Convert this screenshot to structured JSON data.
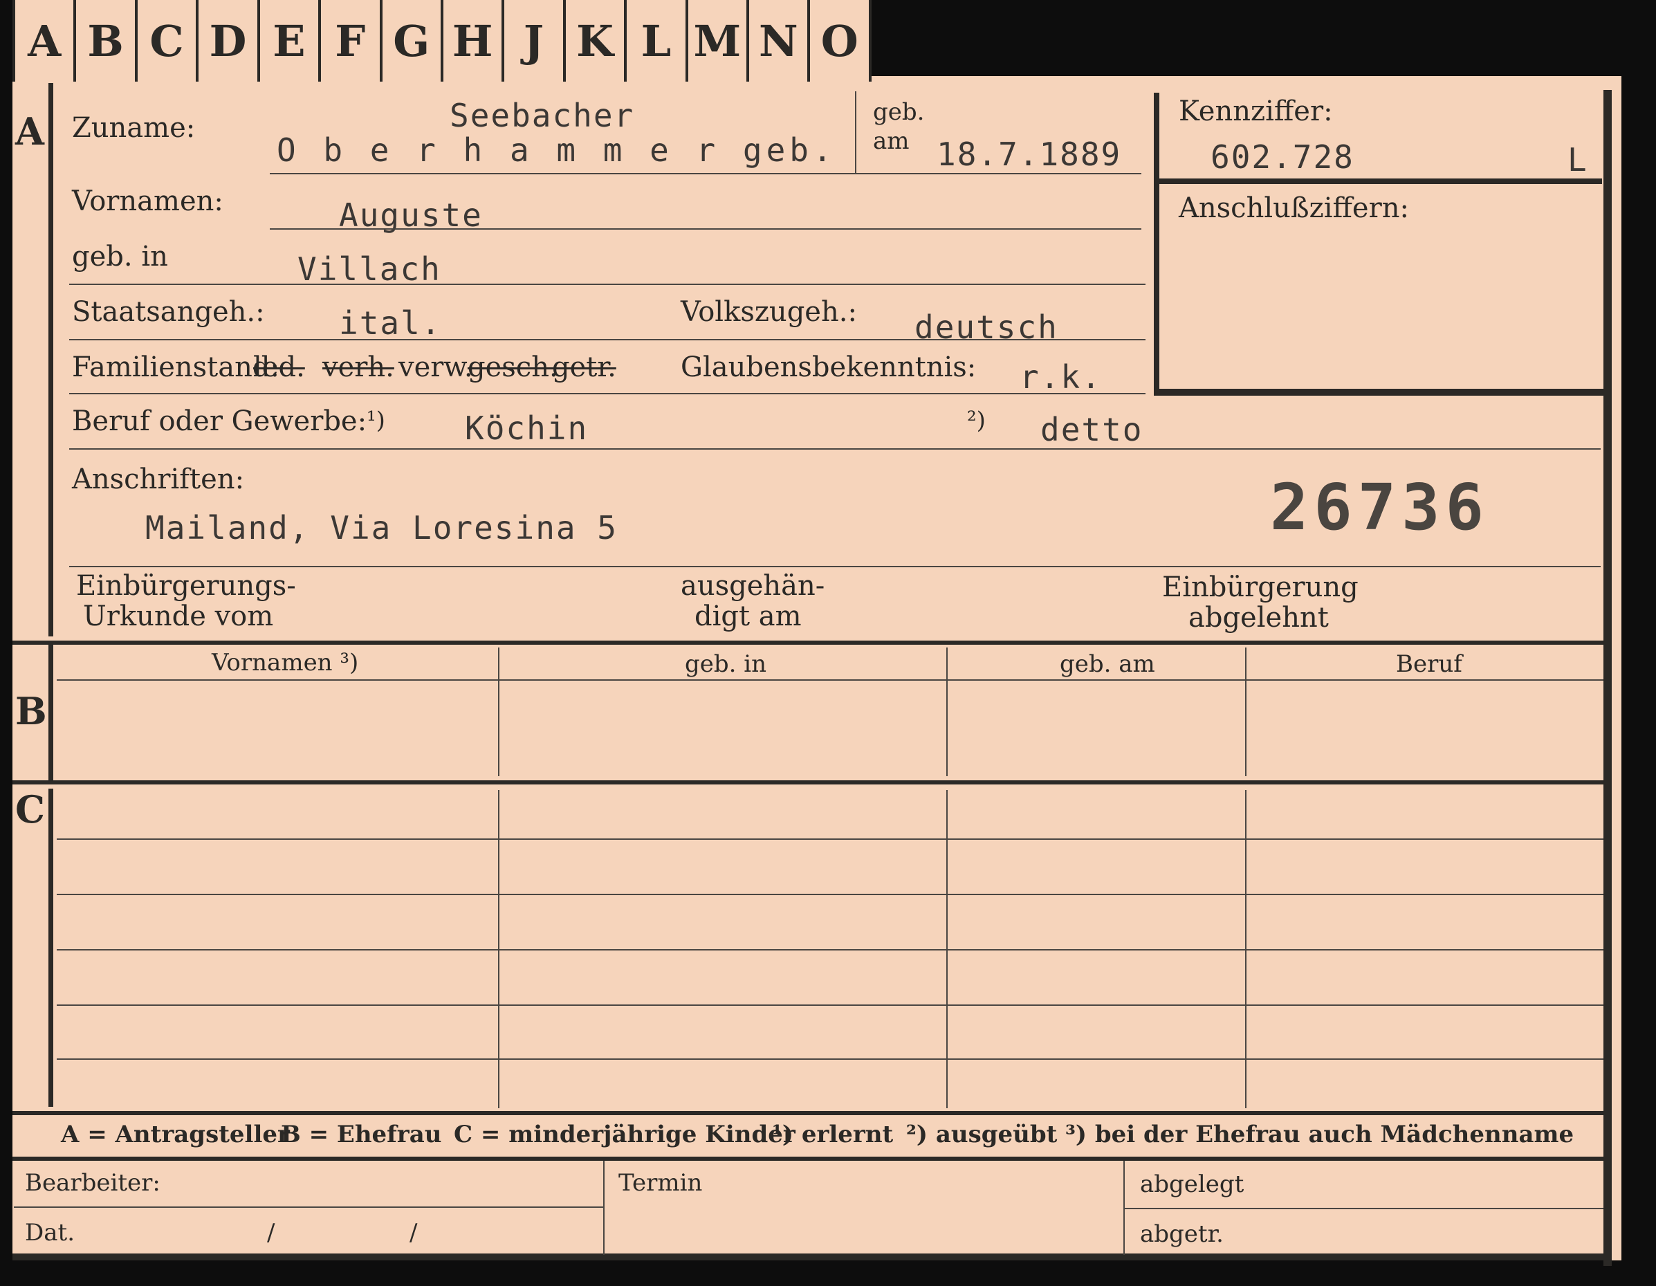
{
  "tabs": [
    "A",
    "B",
    "C",
    "D",
    "E",
    "F",
    "G",
    "H",
    "J",
    "K",
    "L",
    "M",
    "N",
    "O"
  ],
  "section_letters": {
    "a": "A",
    "b": "B",
    "c": "C"
  },
  "fields": {
    "zuname_label": "Zuname:",
    "zuname_value_top": "Seebacher",
    "zuname_value": "O b e r h a m m e r  geb.",
    "geb_label_top": "geb.",
    "geb_label_bottom": "am",
    "geb_am_value": "18.7.1889",
    "kennziffer_label": "Kennziffer:",
    "kennziffer_value": "602.728",
    "kennziffer_suffix": "L",
    "anschluss_label": "Anschlußziffern:",
    "vornamen_label": "Vornamen:",
    "vornamen_value": "Auguste",
    "geb_in_label": "geb. in",
    "geb_in_value": "Villach",
    "staatsangeh_label": "Staatsangeh.:",
    "staatsangeh_value": "ital.",
    "volkszugeh_label": "Volkszugeh.:",
    "volkszugeh_value": "deutsch",
    "familienstand_label": "Familienstand:",
    "familienstand_opt1": "led.",
    "familienstand_opt2": "verh.",
    "familienstand_opt3": "verw.",
    "familienstand_opt4": "gesch.",
    "familienstand_opt5": "getr.",
    "glauben_label": "Glaubensbekenntnis:",
    "glauben_value": "r.k.",
    "beruf_label": "Beruf oder Gewerbe:",
    "beruf_mark1": "¹)",
    "beruf_value1": "Köchin",
    "beruf_mark2": "²)",
    "beruf_value2": "detto",
    "anschriften_label": "Anschriften:",
    "anschriften_value": "Mailand, Via Loresina 5",
    "stamp_number": "26736",
    "einb_label_1": "Einbürgerungs-",
    "einb_label_2": "Urkunde vom",
    "ausgeh_label_1": "ausgehän-",
    "ausgeh_label_2": "digt am",
    "abgelehnt_label_1": "Einbürgerung",
    "abgelehnt_label_2": "abgelehnt"
  },
  "table_headers": [
    "Vornamen ³)",
    "geb. in",
    "geb. am",
    "Beruf"
  ],
  "legend": {
    "a": "A = Antragsteller",
    "b": "B = Ehefrau",
    "c": "C = minderjährige Kinder",
    "n1": "¹) erlernt",
    "n2": "²) ausgeübt",
    "n3": "³) bei der Ehefrau auch Mädchenname"
  },
  "footer": {
    "bearbeiter": "Bearbeiter:",
    "dat": "Dat.",
    "slash1": "/",
    "slash2": "/",
    "termin": "Termin",
    "abgelegt": "abgelegt",
    "abgetr": "abgetr."
  }
}
